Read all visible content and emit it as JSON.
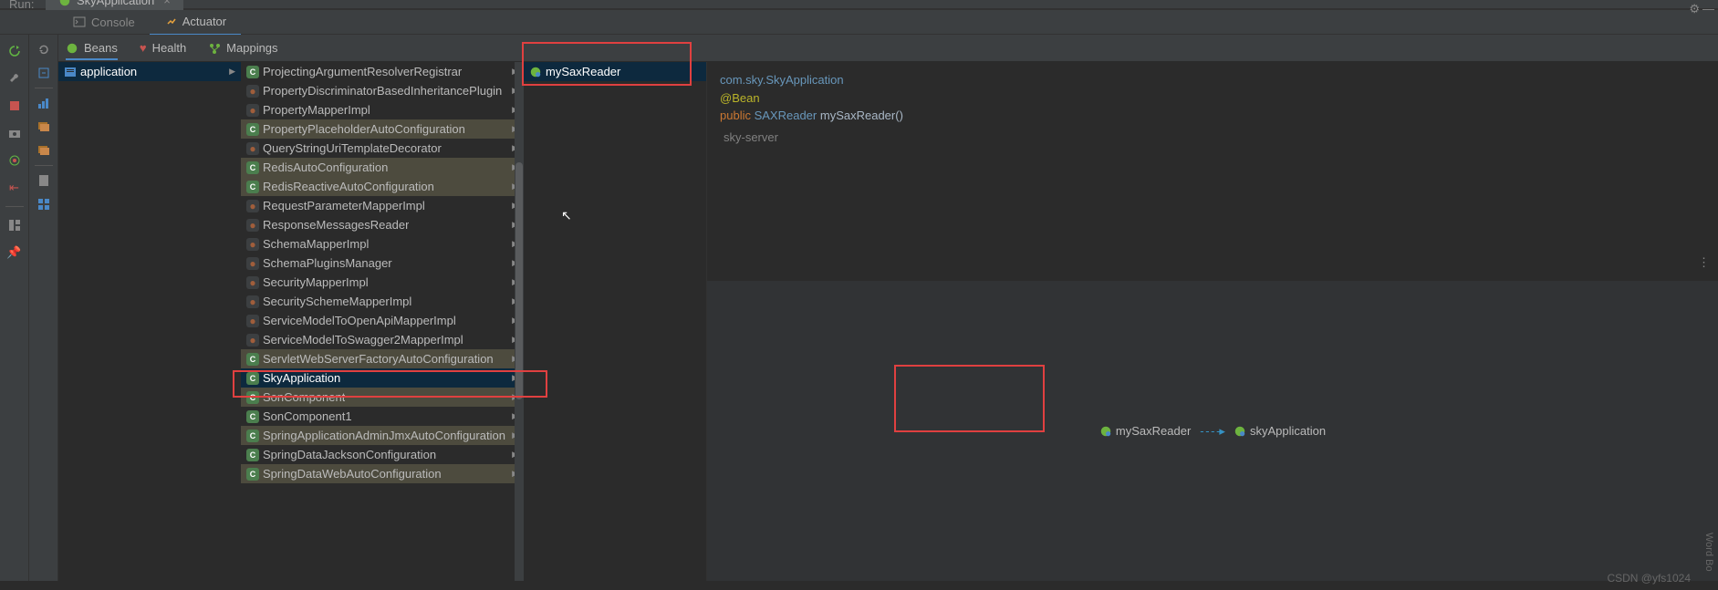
{
  "header": {
    "run_label": "Run:",
    "app_tab": "SkyApplication"
  },
  "tool_tabs": {
    "console": "Console",
    "actuator": "Actuator"
  },
  "filters": {
    "beans": "Beans",
    "health": "Health",
    "mappings": "Mappings"
  },
  "col1": {
    "application": "application"
  },
  "col2": {
    "items": [
      {
        "label": "ProjectingArgumentResolverRegistrar",
        "icon": "c",
        "hl": false
      },
      {
        "label": "PropertyDiscriminatorBasedInheritancePlugin",
        "icon": "o",
        "hl": false
      },
      {
        "label": "PropertyMapperImpl",
        "icon": "o",
        "hl": false
      },
      {
        "label": "PropertyPlaceholderAutoConfiguration",
        "icon": "c",
        "hl": true
      },
      {
        "label": "QueryStringUriTemplateDecorator",
        "icon": "o",
        "hl": false
      },
      {
        "label": "RedisAutoConfiguration",
        "icon": "c",
        "hl": true
      },
      {
        "label": "RedisReactiveAutoConfiguration",
        "icon": "c",
        "hl": true
      },
      {
        "label": "RequestParameterMapperImpl",
        "icon": "o",
        "hl": false
      },
      {
        "label": "ResponseMessagesReader",
        "icon": "o",
        "hl": false
      },
      {
        "label": "SchemaMapperImpl",
        "icon": "o",
        "hl": false
      },
      {
        "label": "SchemaPluginsManager",
        "icon": "o",
        "hl": false
      },
      {
        "label": "SecurityMapperImpl",
        "icon": "o",
        "hl": false
      },
      {
        "label": "SecuritySchemeMapperImpl",
        "icon": "o",
        "hl": false
      },
      {
        "label": "ServiceModelToOpenApiMapperImpl",
        "icon": "o",
        "hl": false
      },
      {
        "label": "ServiceModelToSwagger2MapperImpl",
        "icon": "o",
        "hl": false
      },
      {
        "label": "ServletWebServerFactoryAutoConfiguration",
        "icon": "c",
        "hl": true
      },
      {
        "label": "SkyApplication",
        "icon": "c",
        "hl": false,
        "selected": true
      },
      {
        "label": "SonComponent",
        "icon": "c",
        "hl": true
      },
      {
        "label": "SonComponent1",
        "icon": "c",
        "hl": false
      },
      {
        "label": "SpringApplicationAdminJmxAutoConfiguration",
        "icon": "c",
        "hl": true
      },
      {
        "label": "SpringDataJacksonConfiguration",
        "icon": "c",
        "hl": false
      },
      {
        "label": "SpringDataWebAutoConfiguration",
        "icon": "c",
        "hl": true
      }
    ]
  },
  "col3": {
    "mySaxReader": "mySaxReader"
  },
  "code": {
    "pkg": "com.sky.SkyApplication",
    "anno": "@Bean",
    "kw_public": "public",
    "type": "SAXReader",
    "method": "mySaxReader()",
    "module": "sky-server"
  },
  "graph": {
    "node1": "mySaxReader",
    "node2": "skyApplication"
  },
  "watermark": "CSDN @yfs1024",
  "right_label": "Word Bo"
}
